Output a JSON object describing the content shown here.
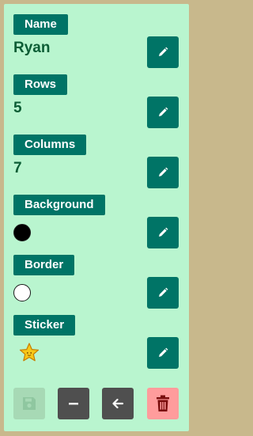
{
  "fields": [
    {
      "label": "Name",
      "value": "Ryan"
    },
    {
      "label": "Rows",
      "value": "5"
    },
    {
      "label": "Columns",
      "value": "7"
    },
    {
      "label": "Background",
      "value_color": "#000000"
    },
    {
      "label": "Border",
      "value_color": "#ffffff"
    },
    {
      "label": "Sticker",
      "value_icon": "star-icon"
    }
  ],
  "icons": {
    "edit": "pencil-icon",
    "save": "save-icon",
    "minus": "minus-icon",
    "back": "arrow-left-icon",
    "delete": "trash-icon"
  },
  "colors": {
    "panel_bg": "#b9f5cf",
    "label_bg": "#007466",
    "value_text": "#0b5d35",
    "save_disabled_bg": "#a7d9b5",
    "dark_button_bg": "#4f4f4f",
    "delete_bg": "#ff9c9c",
    "delete_icon": "#7a0d0d"
  }
}
